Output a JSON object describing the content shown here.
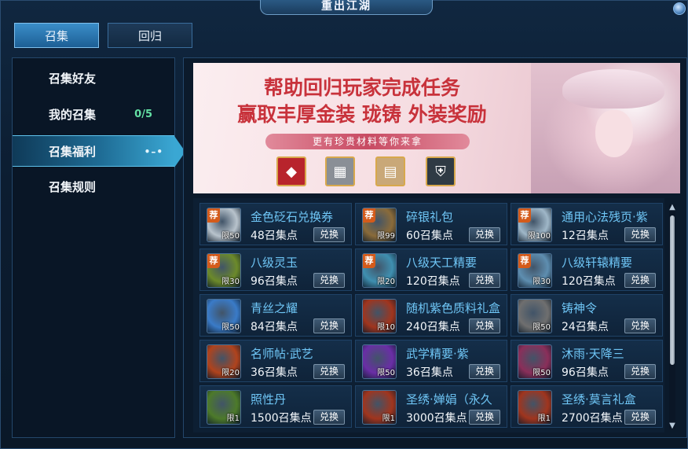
{
  "window": {
    "title": "重出江湖"
  },
  "top_tabs": [
    {
      "label": "召集"
    },
    {
      "label": "回归"
    }
  ],
  "sidebar": {
    "items": [
      {
        "label": "召集好友",
        "count": ""
      },
      {
        "label": "我的召集",
        "count": "0/5"
      },
      {
        "label": "召集福利",
        "count": ""
      },
      {
        "label": "召集规则",
        "count": ""
      }
    ],
    "active_dots": "•–•"
  },
  "banner": {
    "line1": "帮助回归玩家完成任务",
    "line2": "赢取丰厚金装 珑铸 外装奖励",
    "ribbon": "更有珍贵材料等你来拿",
    "icons": [
      "red-gem-icon",
      "armor-icon",
      "book-icon",
      "shield-icon"
    ]
  },
  "items": [
    {
      "name": "金色砭石兑换券",
      "cost": "48召集点",
      "limit": "限50",
      "tag": "荐",
      "button": "兑换",
      "icon": "ticket-icon",
      "color": "#b8c3cc"
    },
    {
      "name": "碎银礼包",
      "cost": "60召集点",
      "limit": "限99",
      "tag": "荐",
      "button": "兑换",
      "icon": "silver-pack-icon",
      "color": "#8a6b3a"
    },
    {
      "name": "通用心法残页·紫",
      "cost": "12召集点",
      "limit": "限100",
      "tag": "荐",
      "button": "兑换",
      "icon": "scroll-page-icon",
      "color": "#9fb7c8"
    },
    {
      "name": "八级灵玉",
      "cost": "96召集点",
      "limit": "限30",
      "tag": "荐",
      "button": "兑换",
      "icon": "jade-icon",
      "color": "#6c8a2a"
    },
    {
      "name": "八级天工精要",
      "cost": "120召集点",
      "limit": "限20",
      "tag": "荐",
      "button": "兑换",
      "icon": "craft-book-icon",
      "color": "#3f8fb0"
    },
    {
      "name": "八级轩辕精要",
      "cost": "120召集点",
      "limit": "限30",
      "tag": "荐",
      "button": "兑换",
      "icon": "xuanyuan-book-icon",
      "color": "#5e8eb0"
    },
    {
      "name": "青丝之耀",
      "cost": "84召集点",
      "limit": "限50",
      "tag": "",
      "button": "兑换",
      "icon": "hair-box-icon",
      "color": "#3a7bc8"
    },
    {
      "name": "随机紫色质料礼盒",
      "cost": "240召集点",
      "limit": "限10",
      "tag": "",
      "button": "兑换",
      "icon": "chest-icon",
      "color": "#a0351e"
    },
    {
      "name": "铸神令",
      "cost": "24召集点",
      "limit": "限50",
      "tag": "",
      "button": "兑换",
      "icon": "token-icon",
      "color": "#6f6f6f"
    },
    {
      "name": "名师帖·武艺",
      "cost": "36召集点",
      "limit": "限20",
      "tag": "",
      "button": "兑换",
      "icon": "master-letter-icon",
      "color": "#b0431d"
    },
    {
      "name": "武学精要·紫",
      "cost": "36召集点",
      "limit": "限50",
      "tag": "",
      "button": "兑换",
      "icon": "purple-manual-icon",
      "color": "#6a2ea6"
    },
    {
      "name": "沐雨·天降三",
      "cost": "96召集点",
      "limit": "限50",
      "tag": "",
      "button": "兑换",
      "icon": "potion-icon",
      "color": "#8a2f5a"
    },
    {
      "name": "照性丹",
      "cost": "1500召集点",
      "limit": "限1",
      "tag": "",
      "button": "兑换",
      "icon": "pill-icon",
      "color": "#4d7a2a"
    },
    {
      "name": "圣绣·婵娟（永久",
      "cost": "3000召集点",
      "limit": "限1",
      "tag": "",
      "button": "兑换",
      "icon": "chest-icon",
      "color": "#a0351e"
    },
    {
      "name": "圣绣·莫言礼盒",
      "cost": "2700召集点",
      "limit": "限1",
      "tag": "",
      "button": "兑换",
      "icon": "chest-icon",
      "color": "#a0351e"
    }
  ]
}
